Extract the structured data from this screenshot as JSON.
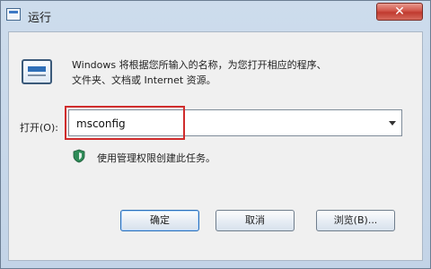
{
  "window": {
    "title": "运行",
    "close_label": "✕"
  },
  "dialog": {
    "description_line1": "Windows 将根据您所输入的名称，为您打开相应的程序、",
    "description_line2": "文件夹、文档或 Internet 资源。",
    "open_label": "打开(O):",
    "input_value": "msconfig",
    "admin_note": "使用管理权限创建此任务。"
  },
  "buttons": {
    "ok": "确定",
    "cancel": "取消",
    "browse": "浏览(B)..."
  },
  "colors": {
    "highlight": "#d02c2c",
    "close_red": "#c03a2f"
  },
  "icons": {
    "title": "run-icon",
    "dialog": "run-icon",
    "admin": "shield-icon",
    "dropdown": "chevron-down-icon",
    "close": "close-icon"
  }
}
